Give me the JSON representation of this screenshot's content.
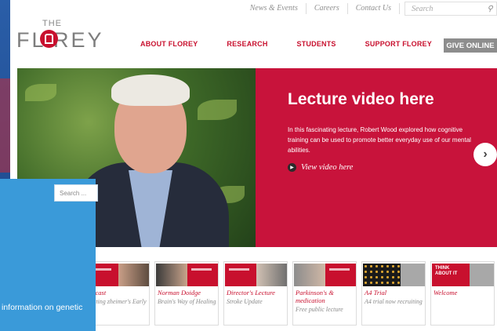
{
  "utility_nav": {
    "links": [
      "News & Events",
      "Careers",
      "Contact Us"
    ],
    "search_placeholder": "Search"
  },
  "logo": {
    "the": "THE",
    "word": "FL REY"
  },
  "main_nav": {
    "items": [
      "ABOUT FLOREY",
      "RESEARCH",
      "STUDENTS",
      "SUPPORT FLOREY"
    ],
    "give": "GIVE ONLINE"
  },
  "hero": {
    "title": "Lecture video here",
    "description": "In this fascinating lecture, Robert Wood explored how cognitive training can be used to promote better everyday use of our mental abilities.",
    "link": "View video here",
    "next": "›"
  },
  "cards": [
    {
      "title": "odcast",
      "subtitle": "tecting zheimer's Early"
    },
    {
      "title": "Norman Doidge",
      "subtitle": "Brain's Way of Healing"
    },
    {
      "title": "Director's Lecture",
      "subtitle": "Stroke Update"
    },
    {
      "title": "Parkinson's & medication",
      "subtitle": "Free public lecture"
    },
    {
      "title": "A4 Trial",
      "subtitle": "A4 trial now recruiting"
    },
    {
      "title": "Welcome",
      "subtitle": "",
      "image_text": "THINK ABOUT IT"
    }
  ],
  "overlay": {
    "search_placeholder": "Search ...",
    "text": "information on genetic"
  },
  "colors": {
    "brand_red": "#c8102e",
    "overlay_blue": "#3a9ad9",
    "give_grey": "#8d8d8d"
  }
}
